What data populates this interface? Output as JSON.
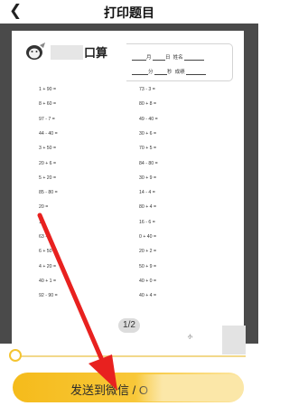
{
  "header": {
    "back_icon": "chevron-left-icon",
    "title": "打印题目"
  },
  "worksheet": {
    "app_title": "口算",
    "fields": {
      "month": "月",
      "day": "日",
      "name": "姓名",
      "minute": "分",
      "second": "秒",
      "score": "成绩"
    },
    "left_problems": [
      "1 + 90 =",
      "8 + 60 =",
      "97 - 7 =",
      "44 - 40 =",
      "3 + 50 =",
      "20 + 6 =",
      "5 + 20 =",
      "85 - 80 =",
      "20 =",
      "1",
      "63 - 6",
      "6 + 50 =",
      "4 + 20 =",
      "40 + 1 =",
      "92 - 90 ="
    ],
    "right_problems": [
      "73 - 3 =",
      "80 + 8 =",
      "49 - 40 =",
      "30 + 6 =",
      "70 + 5 =",
      "84 - 80 =",
      "30 + 9 =",
      "14 - 4 =",
      "80 + 4 =",
      "16 - 6 =",
      "0 + 40 =",
      "20 + 2 =",
      "50 + 9 =",
      "40 + 0 =",
      "40 + 4 ="
    ],
    "qr_caption": "小"
  },
  "pager": {
    "text": "1/2"
  },
  "slider": {
    "value": 0
  },
  "send_button": {
    "label": "发送到微信 / O"
  },
  "colors": {
    "accent": "#f5bb1b",
    "arrow": "#e8211f",
    "preview_bg": "#4a4a4a"
  }
}
